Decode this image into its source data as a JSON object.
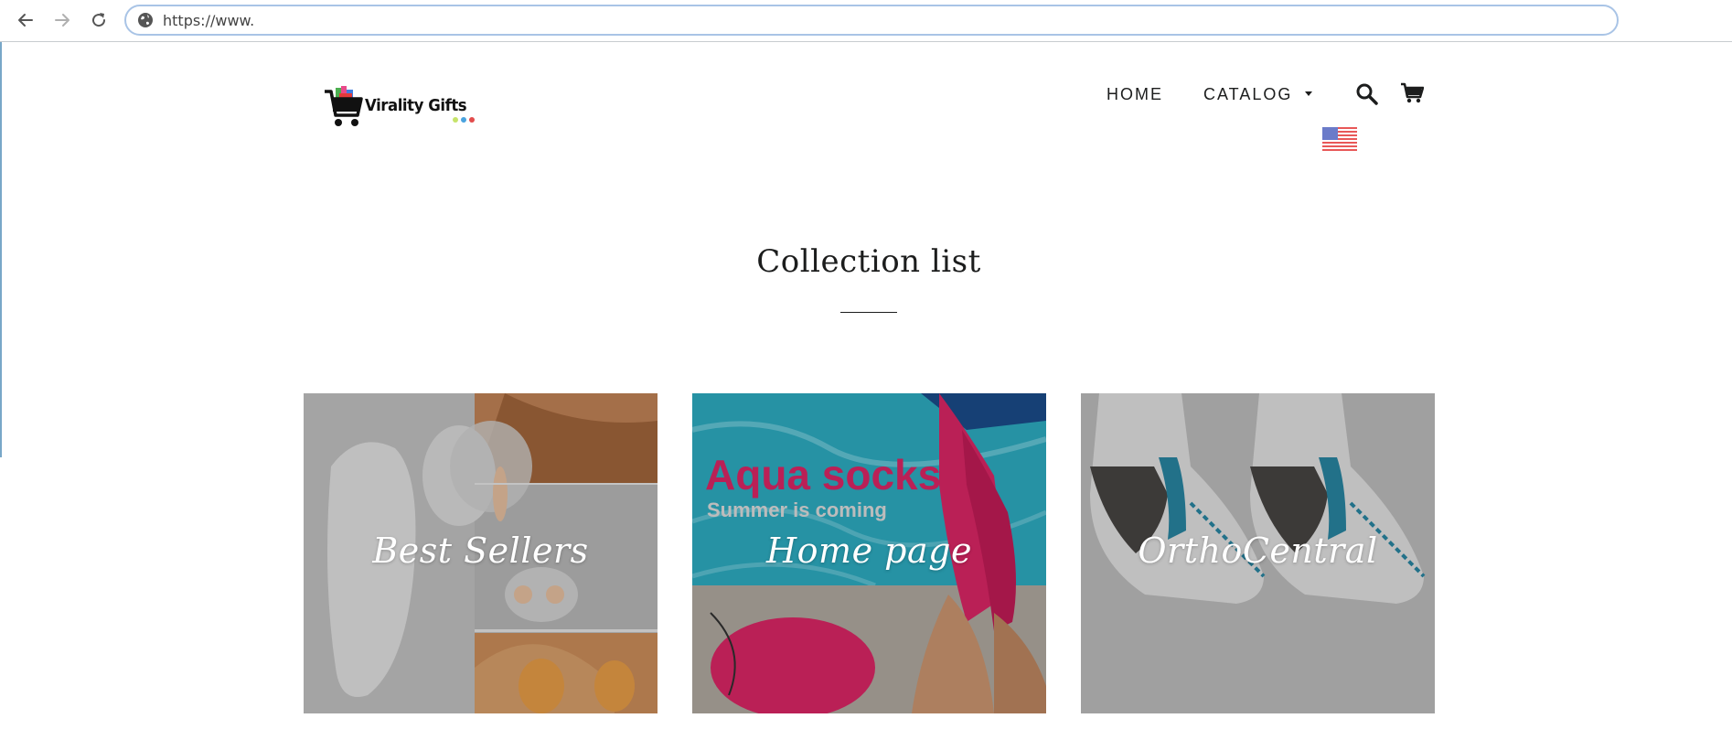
{
  "browser": {
    "url": "https://www.",
    "icons": [
      "back-arrow-icon",
      "forward-arrow-icon",
      "reload-icon",
      "globe-icon"
    ]
  },
  "header": {
    "logo_text": "Virality Gifts",
    "nav": {
      "home": "HOME",
      "catalog": "CATALOG"
    },
    "icons": [
      "search-icon",
      "cart-icon",
      "us-flag-icon",
      "caret-down-icon"
    ]
  },
  "section": {
    "title": "Collection list"
  },
  "collections": [
    {
      "title": "Best Sellers"
    },
    {
      "title": "Home page"
    },
    {
      "title": "OrthoCentral"
    }
  ],
  "collection_images": {
    "aqua_text": "Aqua socks",
    "aqua_subtext": "Summer is coming"
  },
  "colors": {
    "text": "#1c1d1d",
    "address_border": "#a9c4e6",
    "pool_blue": "#2fb3c9",
    "sock_pink": "#e3286a"
  }
}
